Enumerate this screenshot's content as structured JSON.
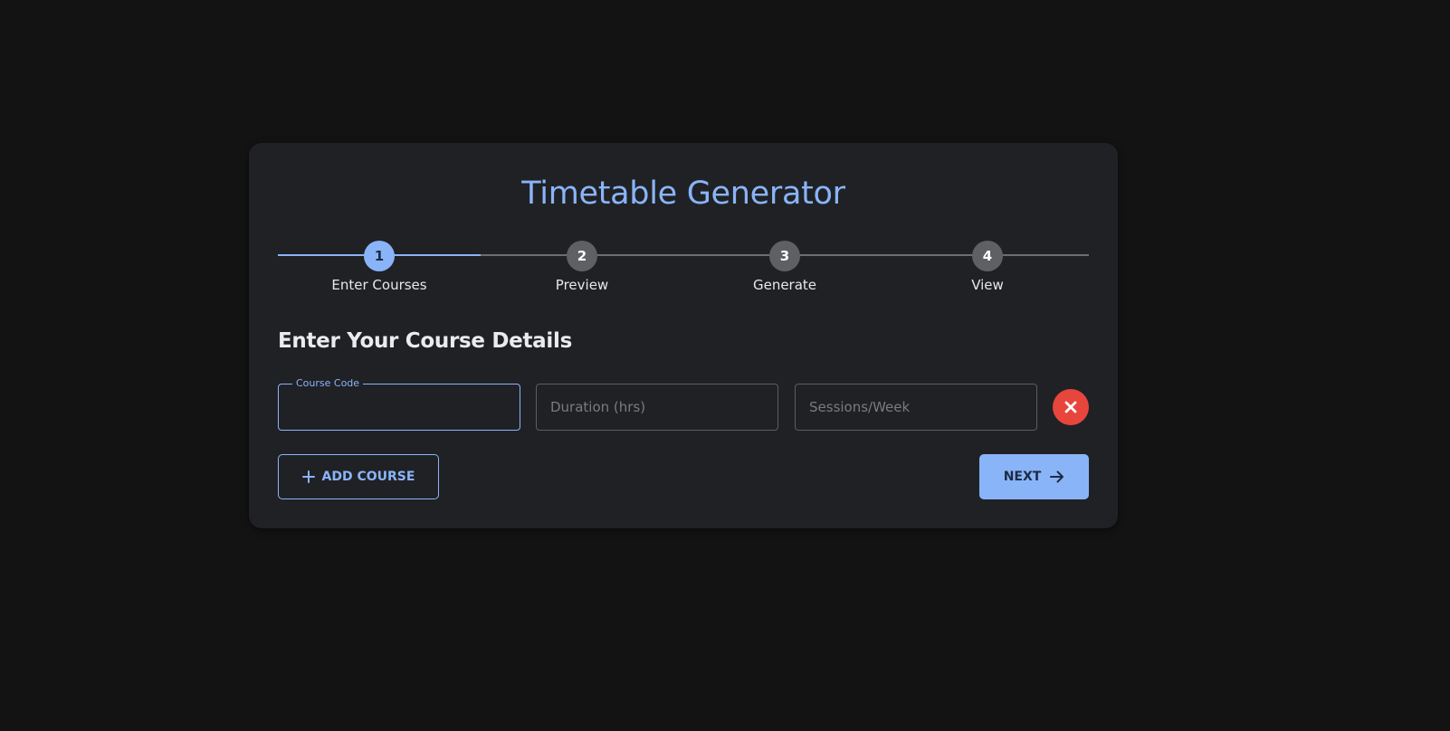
{
  "header": {
    "title": "Timetable Generator"
  },
  "stepper": {
    "active_step": 1,
    "steps": [
      {
        "number": "1",
        "label": "Enter Courses"
      },
      {
        "number": "2",
        "label": "Preview"
      },
      {
        "number": "3",
        "label": "Generate"
      },
      {
        "number": "4",
        "label": "View"
      }
    ]
  },
  "form": {
    "section_title": "Enter Your Course Details",
    "course_code": {
      "label": "Course Code",
      "value": ""
    },
    "duration": {
      "placeholder": "Duration (hrs)",
      "value": ""
    },
    "sessions": {
      "placeholder": "Sessions/Week",
      "value": ""
    }
  },
  "actions": {
    "add_course_label": "ADD COURSE",
    "next_label": "NEXT"
  },
  "icons": {
    "remove": "close-icon",
    "add": "plus-icon",
    "next": "arrow-right-icon"
  },
  "colors": {
    "background": "#131313",
    "card": "#202125",
    "accent": "#8ab4f8",
    "danger": "#e8453c",
    "inactive_step": "#5f6063"
  }
}
